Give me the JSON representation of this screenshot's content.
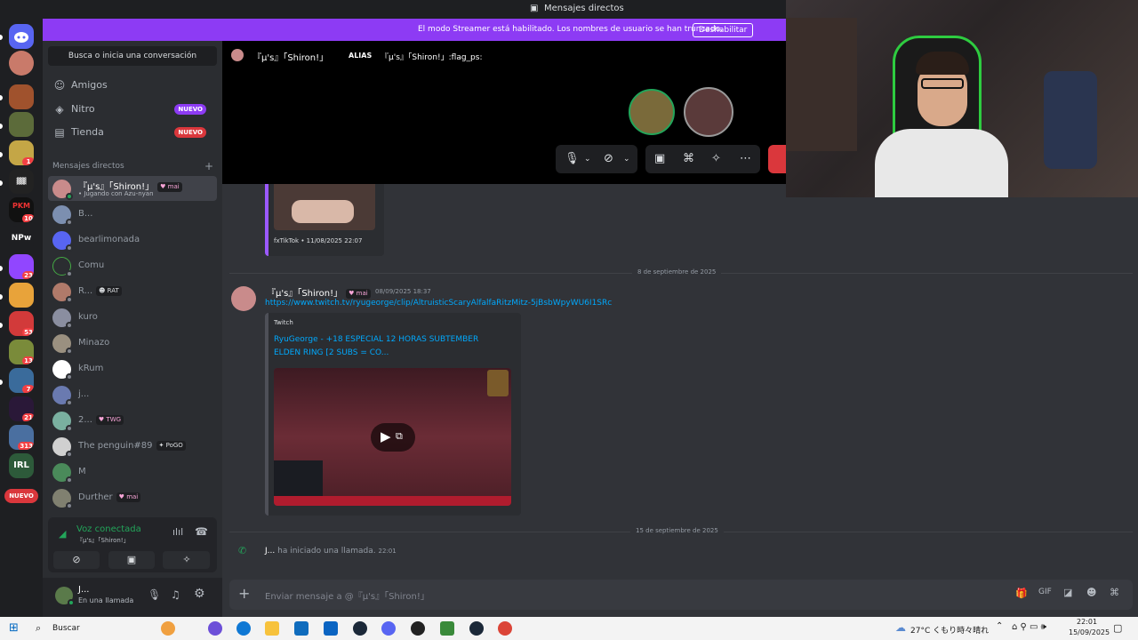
{
  "window": {
    "title": "Mensajes directos"
  },
  "banner": {
    "message": "El modo Streamer está habilitado. Los nombres de usuario se han truncado.",
    "button": "Deshabilitar"
  },
  "servers": [
    {
      "badge": ""
    },
    {
      "badge": ""
    },
    {
      "badge": ""
    },
    {
      "badge": "1"
    },
    {
      "badge": ""
    },
    {
      "badge": "10"
    },
    {
      "badge": ""
    },
    {
      "badge": "23"
    },
    {
      "badge": ""
    },
    {
      "badge": "53"
    },
    {
      "badge": "13"
    },
    {
      "badge": "7"
    },
    {
      "badge": "21"
    },
    {
      "badge": "313"
    },
    {
      "badge": ""
    }
  ],
  "server_labels": {
    "npw": "NPw",
    "irl": "IRL",
    "nuevo": "NUEVO",
    "pkm": "PKM",
    "mods": "MODS"
  },
  "sidebar": {
    "search": "Busca o inicia una conversación",
    "nav": [
      {
        "label": "Amigos",
        "badge": ""
      },
      {
        "label": "Nitro",
        "badge": "NUEVO"
      },
      {
        "label": "Tienda",
        "badge": "NUEVO"
      }
    ],
    "dm_header": "Mensajes directos",
    "dms": [
      {
        "name": "『µ's』「Shiron!」",
        "tag": "mai",
        "sub": "• Jugando con Azu-nyan"
      },
      {
        "name": "B...",
        "tag": "",
        "sub": ""
      },
      {
        "name": "bearlimonada",
        "tag": "",
        "sub": ""
      },
      {
        "name": "Comu",
        "tag": "",
        "sub": ""
      },
      {
        "name": "R...",
        "tag": "RAT",
        "sub": ""
      },
      {
        "name": "kuro",
        "tag": "",
        "sub": ""
      },
      {
        "name": "Minazo",
        "tag": "",
        "sub": ""
      },
      {
        "name": "kRum",
        "tag": "",
        "sub": ""
      },
      {
        "name": "j...",
        "tag": "",
        "sub": ""
      },
      {
        "name": "2...",
        "tag": "TWG",
        "sub": ""
      },
      {
        "name": "The penguin#89",
        "tag": "PoGO",
        "sub": ""
      },
      {
        "name": "M",
        "tag": "",
        "sub": ""
      },
      {
        "name": "Durther",
        "tag": "mai",
        "sub": ""
      }
    ]
  },
  "voice": {
    "status": "Voz conectada",
    "channel": "『µ's』「Shiron!」"
  },
  "user": {
    "name": "J...",
    "status": "En una llamada"
  },
  "call_header": {
    "name": "『µ's』「Shiron!」",
    "alias_label": "ALIAS",
    "alias": "『µ's』「Shiron!」:flag_ps:"
  },
  "messages": {
    "embed_prev_footer": "fxTikTok • 11/08/2025 22:07",
    "date1": "8 de septiembre de 2025",
    "author": "『µ's』「Shiron!」",
    "author_tag": "mai",
    "timestamp": "08/09/2025 18:37",
    "link": "https://www.twitch.tv/ryugeorge/clip/AltruisticScaryAlfalfaRitzMitz-5jBsbWpyWU6I1SRc",
    "embed_provider": "Twitch",
    "embed_title": "RyuGeorge - +18 ESPECIAL 12 HORAS SUBTEMBER ELDEN RING [2 SUBS = CO...",
    "date2": "15 de septiembre de 2025",
    "call_user": "J...",
    "call_text": "ha iniciado una llamada.",
    "call_time": "22:01"
  },
  "composer": {
    "placeholder": "Enviar mensaje a @『µ's』「Shiron!」"
  },
  "taskbar": {
    "search": "Buscar",
    "weather": "27°C くもり時々晴れ",
    "time": "22:01",
    "date": "15/09/2025"
  },
  "colors": {
    "banner": "#8d3bf4",
    "accent": "#5865f2",
    "online": "#23a55a",
    "danger": "#da373c",
    "link": "#00a8fc"
  }
}
